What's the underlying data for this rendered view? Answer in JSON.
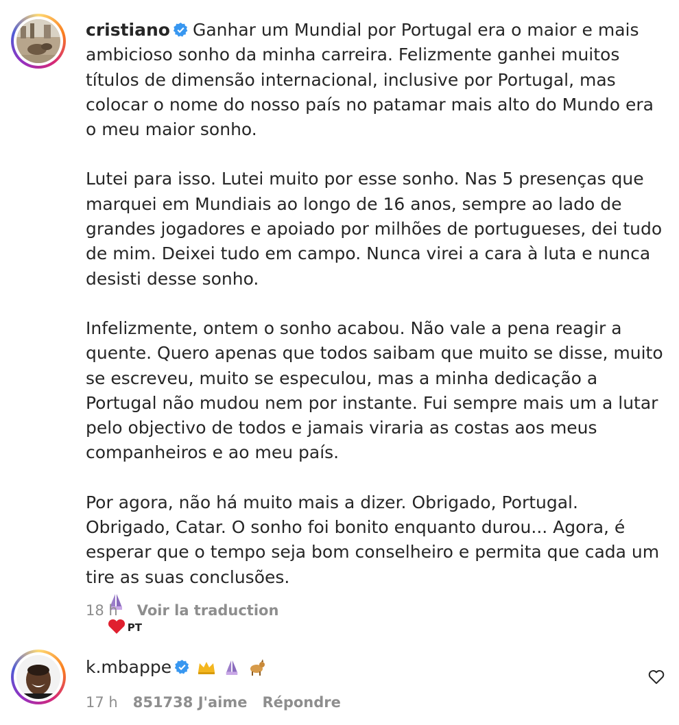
{
  "post": {
    "username": "cristiano",
    "verified_icon": "verified-badge-icon",
    "paragraphs": [
      "Ganhar um Mundial por Portugal era o maior e mais ambicioso sonho da minha carreira. Felizmente ganhei muitos títulos de dimensão internacional, inclusive por Portugal, mas colocar o nome do nosso país no patamar mais alto do Mundo era o meu maior sonho.",
      "Lutei para isso. Lutei muito por esse sonho. Nas 5 presenças que marquei em Mundiais ao longo de 16 anos, sempre ao lado de grandes jogadores e apoiado por milhões de portugueses, dei tudo de mim. Deixei tudo em campo. Nunca virei a cara à luta e nunca desisti desse sonho.",
      "Infelizmente, ontem o sonho acabou. Não vale a pena reagir a quente. Quero apenas que todos saibam que muito se disse, muito se escreveu, muito se especulou, mas a minha dedicação a Portugal não mudou nem por instante. Fui sempre mais um a lutar pelo objectivo de todos e jamais viraria as costas aos meus companheiros e ao meu país.",
      "Por agora, não há muito mais a dizer. Obrigado, Portugal. Obrigado, Catar. O sonho foi bonito enquanto durou... Agora, é esperar que o tempo seja bom conselheiro e permita que cada um tire as suas conclusões."
    ],
    "trailing_emojis": [
      "praying-hands-icon",
      "red-heart-icon"
    ],
    "flag_text": "PT",
    "time": "18 h",
    "translate_label": "Voir la traduction"
  },
  "comment": {
    "username": "k.mbappe",
    "emojis": [
      "crown-icon",
      "praying-hands-icon",
      "goat-icon"
    ],
    "time": "17 h",
    "likes": "851738 J'aime",
    "reply_label": "Répondre"
  },
  "colors": {
    "text": "#262626",
    "meta": "#8e8e8e",
    "verified": "#3897f0"
  }
}
